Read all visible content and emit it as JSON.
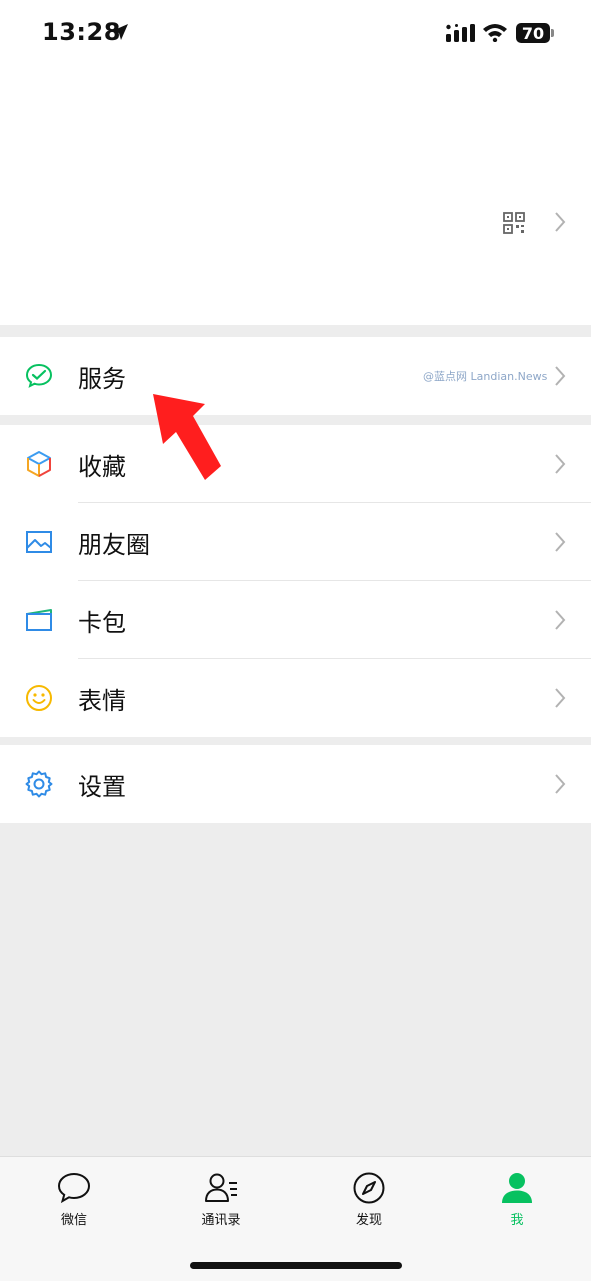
{
  "status_bar": {
    "time": "13:28",
    "battery": "70"
  },
  "menu": {
    "services": {
      "label": "服务",
      "watermark": "@蓝点网 Landian.News",
      "icon": "wechat-pay-icon"
    },
    "favorites": {
      "label": "收藏",
      "icon": "cube-icon"
    },
    "moments": {
      "label": "朋友圈",
      "icon": "image-icon"
    },
    "cards": {
      "label": "卡包",
      "icon": "card-icon"
    },
    "stickers": {
      "label": "表情",
      "icon": "smiley-icon"
    },
    "settings": {
      "label": "设置",
      "icon": "gear-icon"
    }
  },
  "tabbar": {
    "tabs": [
      {
        "label": "微信",
        "icon": "chat-bubble-icon",
        "active": false
      },
      {
        "label": "通讯录",
        "icon": "contacts-icon",
        "active": false
      },
      {
        "label": "发现",
        "icon": "compass-icon",
        "active": false
      },
      {
        "label": "我",
        "icon": "person-icon",
        "active": true
      }
    ]
  },
  "colors": {
    "accent": "#07c160",
    "annotation_arrow": "#ff1e1e"
  }
}
